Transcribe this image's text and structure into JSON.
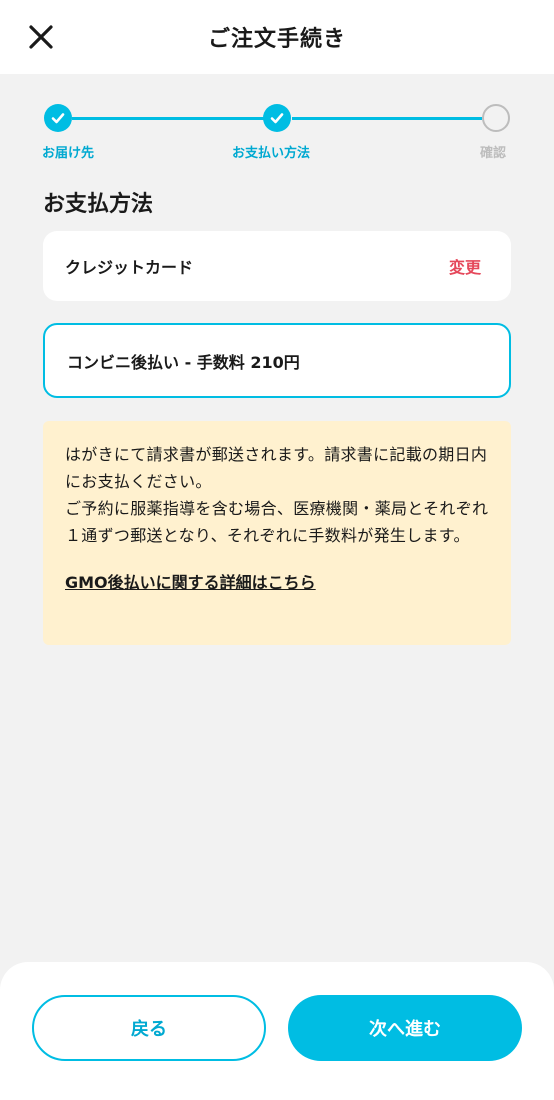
{
  "header": {
    "title": "ご注文手続き",
    "close_icon": "close-icon"
  },
  "stepper": {
    "steps": [
      {
        "label": "お届け先",
        "state": "done"
      },
      {
        "label": "お支払い方法",
        "state": "done"
      },
      {
        "label": "確認",
        "state": "todo"
      }
    ]
  },
  "payment": {
    "section_title": "お支払方法",
    "credit_card_label": "クレジットカード",
    "change_label": "変更",
    "konbini_label": "コンビニ後払い - 手数料 210円"
  },
  "notice": {
    "text_line1": "はがきにて請求書が郵送されます。請求書に記載の期日内にお支払ください。",
    "text_line2": "ご予約に服薬指導を含む場合、医療機関・薬局とそれぞれ１通ずつ郵送となり、それぞれに手数料が発生します。",
    "link_label": "GMO後払いに関する詳細はこちら"
  },
  "footer": {
    "back_label": "戻る",
    "next_label": "次へ進む"
  },
  "colors": {
    "accent": "#00bde3",
    "change": "#e5485b",
    "notice_bg": "#fff1cf",
    "inactive": "#bdbdbd"
  }
}
